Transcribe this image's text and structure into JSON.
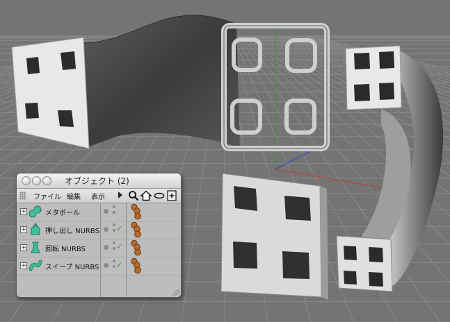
{
  "window": {
    "title": "オブジェクト (2)",
    "menus": [
      "ファイル",
      "編集",
      "表示"
    ],
    "toolbar_icons": [
      "search-icon",
      "home-icon",
      "view-oval-icon",
      "add-window-icon"
    ]
  },
  "objects": [
    {
      "name": "メタボール",
      "icon": "metaball-icon",
      "checked": false
    },
    {
      "name": "押し出し NURBS",
      "icon": "extrude-nurbs-icon",
      "checked": true
    },
    {
      "name": "回転 NURBS",
      "icon": "lathe-nurbs-icon",
      "checked": true
    },
    {
      "name": "スイープ NURBS",
      "icon": "sweep-nurbs-icon",
      "checked": true
    }
  ],
  "colors": {
    "viewport_bg": "#747474",
    "grid": "#8a8a8a",
    "object_icon": "#3fbf9a",
    "check": "#2a9d3a",
    "tag_sphere": "#b86a2a",
    "axis_x": "#c43a3a",
    "axis_y": "#2f9a3a",
    "axis_z": "#3a4acb"
  }
}
